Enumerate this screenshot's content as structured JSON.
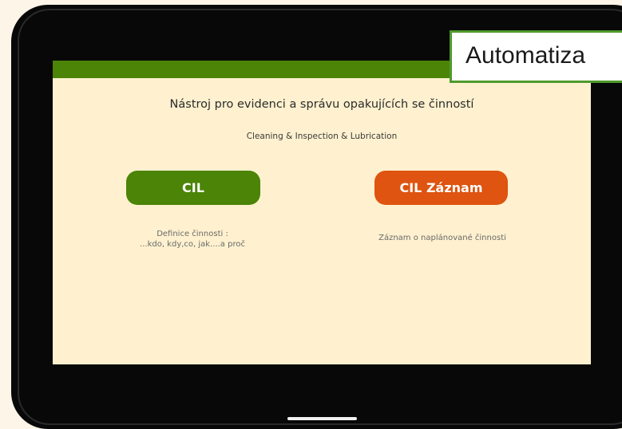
{
  "overlay": {
    "title": "Automatiza"
  },
  "app": {
    "headline": "Nástroj pro evidenci a správu opakujících se činností",
    "subline": "Cleaning & Inspection & Lubrication",
    "buttons": {
      "cil": {
        "label": "CIL",
        "color": "#4b8407",
        "caption_line1": "Definice činnosti :",
        "caption_line2": "...kdo, kdy,co, jak....a proč"
      },
      "zaznam": {
        "label": "CIL Záznam",
        "color": "#de5410",
        "caption": "Záznam o naplánované  činnosti"
      }
    },
    "colors": {
      "header_bar": "#4b8407",
      "screen_background": "#fff1cf",
      "frame": "#080808",
      "page_background": "#fdf5e8"
    }
  }
}
